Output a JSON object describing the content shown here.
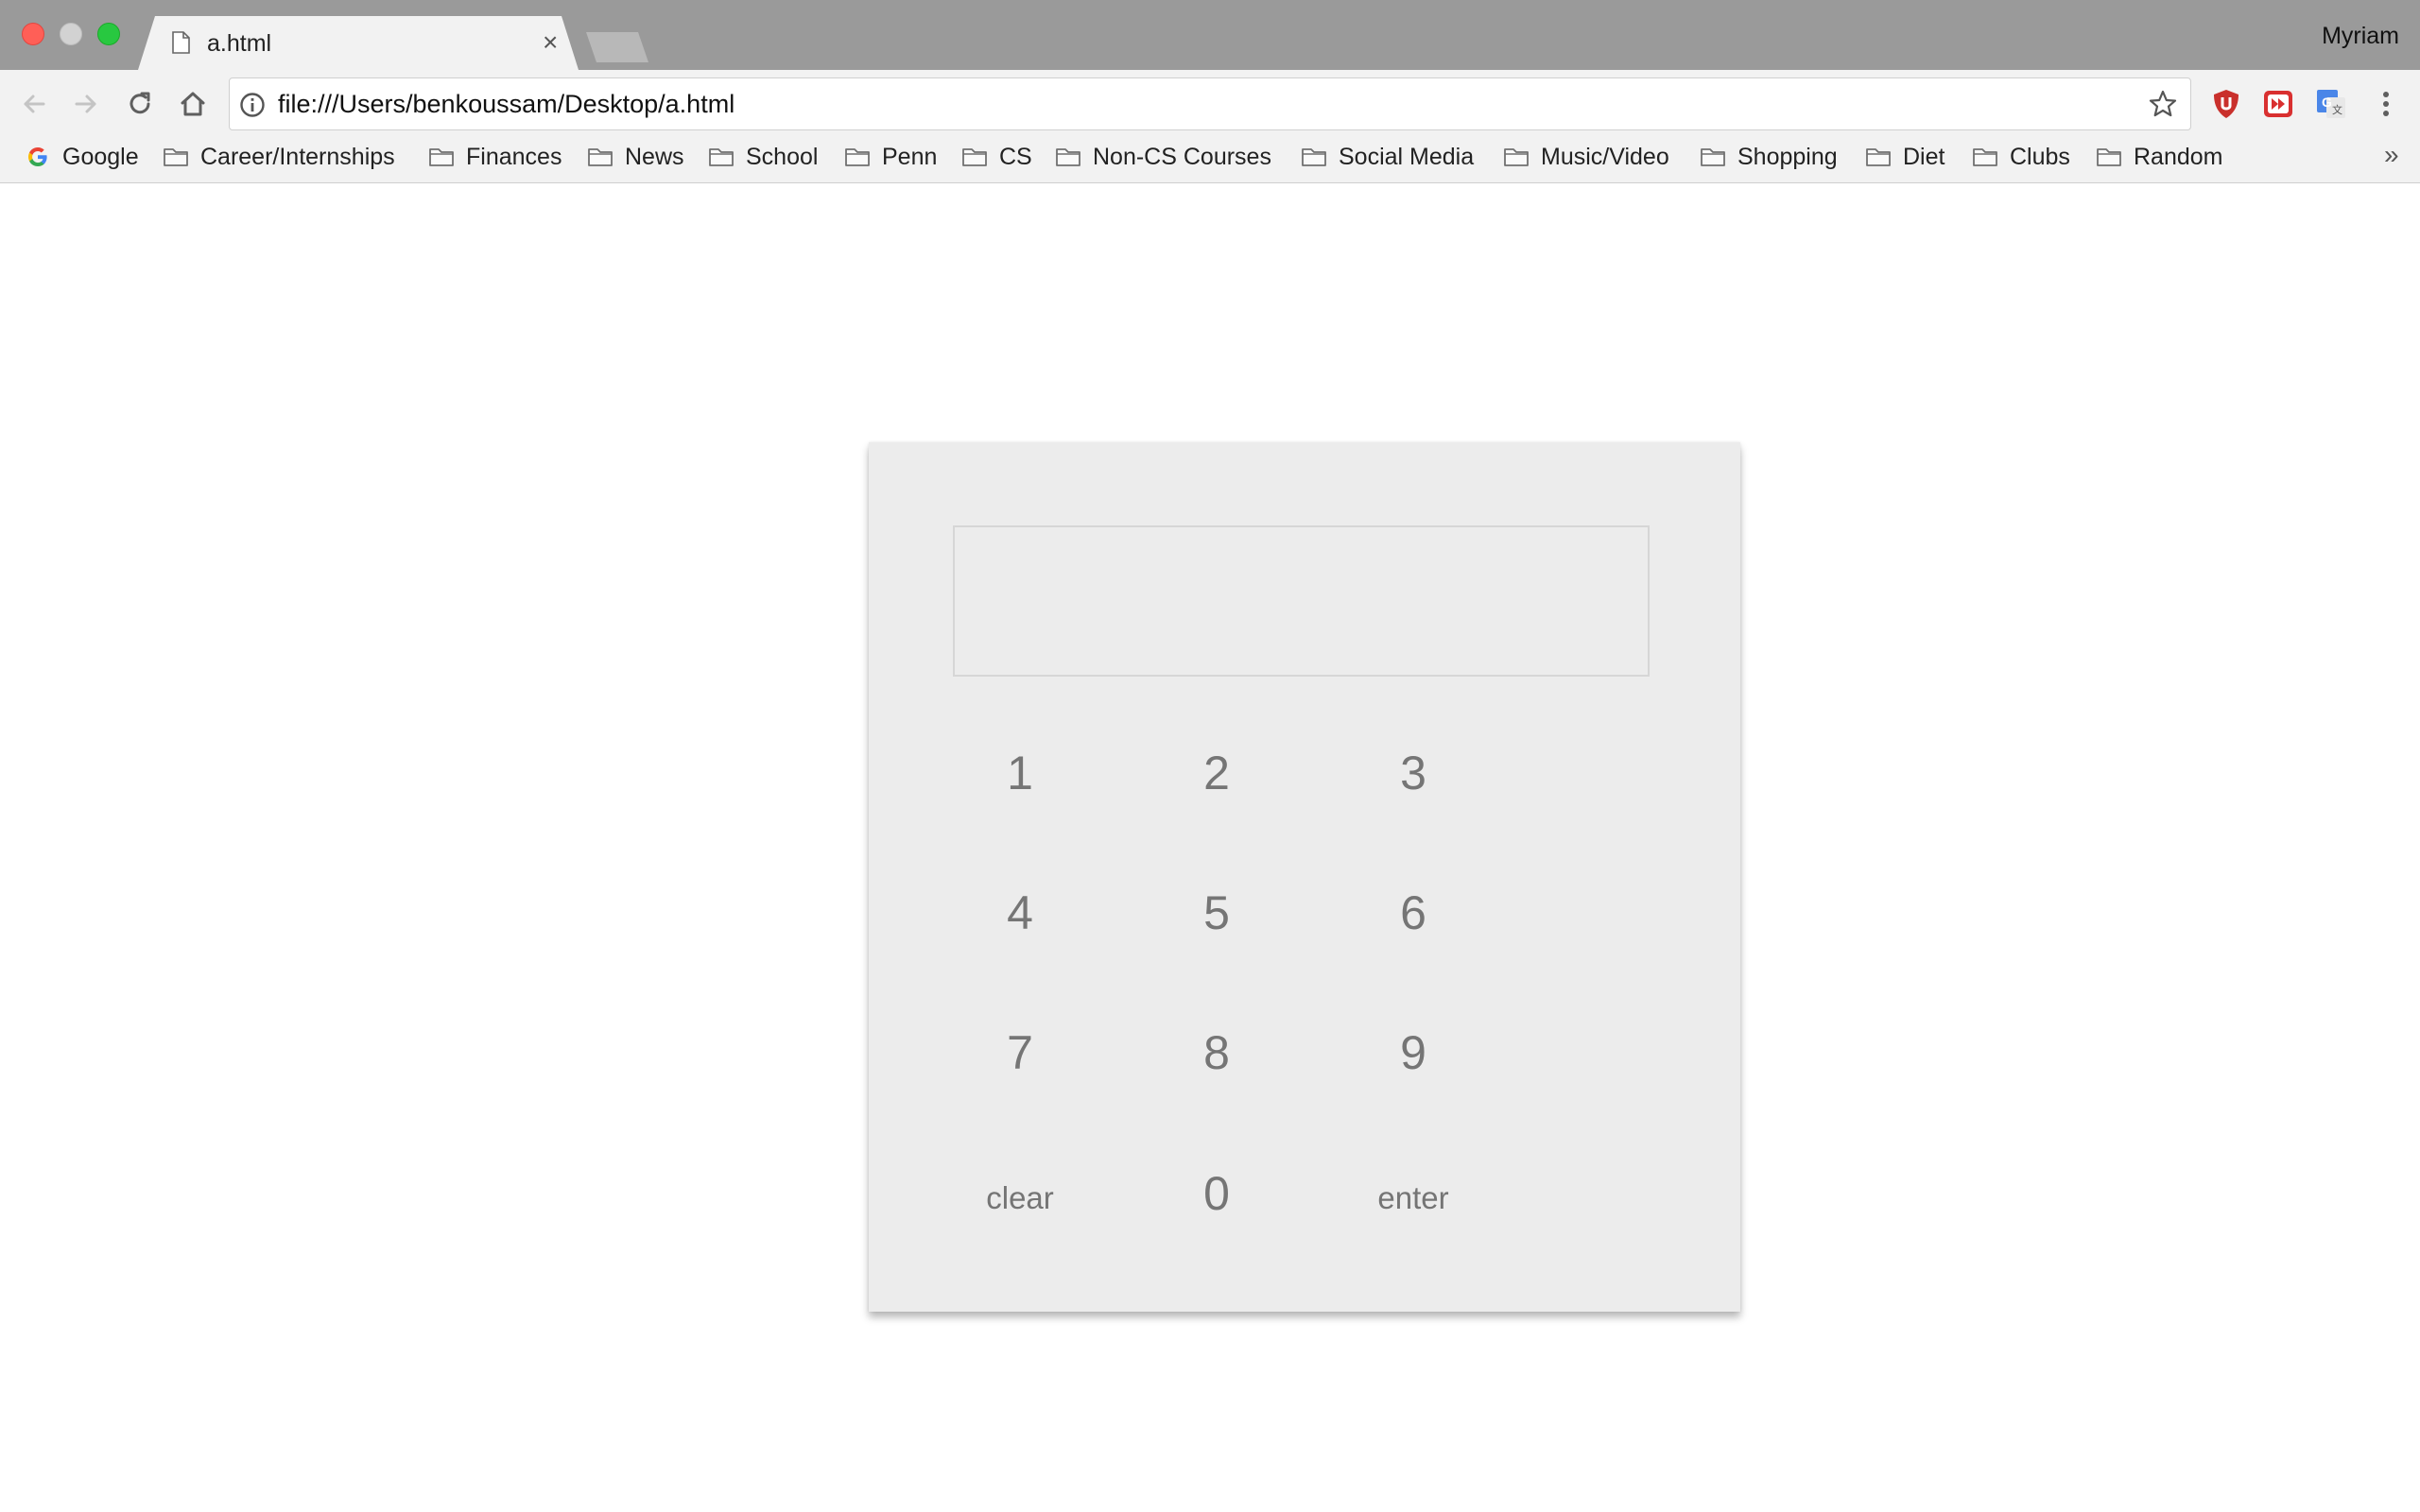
{
  "browser": {
    "profile_name": "Myriam",
    "tab": {
      "title": "a.html"
    },
    "url": "file:///Users/benkoussam/Desktop/a.html",
    "traffic_colors": {
      "close": "#ff5f57",
      "minimize": "#d2d2d2",
      "maximize": "#28c840"
    },
    "toolbar_icons": [
      "back-arrow-icon",
      "forward-arrow-icon",
      "reload-icon",
      "home-icon",
      "info-icon",
      "star-icon",
      "ublock-icon",
      "video-speed-icon",
      "google-translate-icon",
      "menu-dots-icon"
    ]
  },
  "bookmarks": {
    "items": [
      {
        "label": "Google",
        "icon": "google-g-icon"
      },
      {
        "label": "Career/Internships",
        "icon": "folder-icon"
      },
      {
        "label": "Finances",
        "icon": "folder-icon"
      },
      {
        "label": "News",
        "icon": "folder-icon"
      },
      {
        "label": "School",
        "icon": "folder-icon"
      },
      {
        "label": "Penn",
        "icon": "folder-icon"
      },
      {
        "label": "CS",
        "icon": "folder-icon"
      },
      {
        "label": "Non-CS Courses",
        "icon": "folder-icon"
      },
      {
        "label": "Social Media",
        "icon": "folder-icon"
      },
      {
        "label": "Music/Video",
        "icon": "folder-icon"
      },
      {
        "label": "Shopping",
        "icon": "folder-icon"
      },
      {
        "label": "Diet",
        "icon": "folder-icon"
      },
      {
        "label": "Clubs",
        "icon": "folder-icon"
      },
      {
        "label": "Random",
        "icon": "folder-icon"
      }
    ],
    "overflow_label": "»"
  },
  "keypad": {
    "display_value": "",
    "keys": [
      "1",
      "2",
      "3",
      "4",
      "5",
      "6",
      "7",
      "8",
      "9",
      "clear",
      "0",
      "enter"
    ],
    "colors": {
      "panel": "#ececec",
      "key_text": "#757575",
      "display_border": "#d6d6d6"
    }
  }
}
